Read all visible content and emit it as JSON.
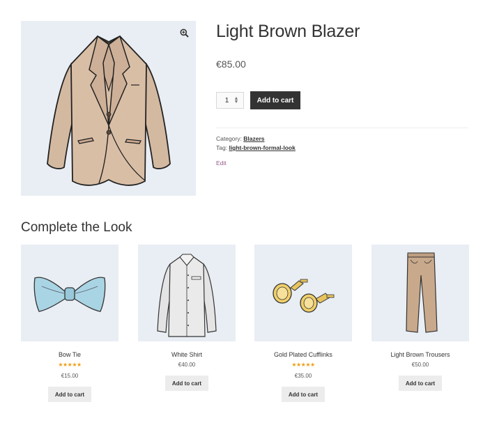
{
  "product": {
    "title": "Light Brown Blazer",
    "price": "€85.00",
    "quantity": "1",
    "add_to_cart_label": "Add to cart",
    "category_label": "Category:",
    "category_value": "Blazers",
    "tag_label": "Tag:",
    "tag_value": "light-brown-formal-look",
    "edit_label": "Edit"
  },
  "section_title": "Complete the Look",
  "related": [
    {
      "name": "Bow Tie",
      "rating": "★★★★★",
      "price": "€15.00",
      "button": "Add to cart"
    },
    {
      "name": "White Shirt",
      "rating": "",
      "price": "€40.00",
      "button": "Add to cart"
    },
    {
      "name": "Gold Plated Cufflinks",
      "rating": "★★★★★",
      "price": "€35.00",
      "button": "Add to cart"
    },
    {
      "name": "Light Brown Trousers",
      "rating": "",
      "price": "€50.00",
      "button": "Add to cart"
    }
  ],
  "colors": {
    "image_bg": "#e9eef4",
    "primary_button": "#333333",
    "secondary_button": "#ececec",
    "star": "#ee9e12",
    "edit_link": "#96588a"
  },
  "icons": {
    "zoom": "magnifier-plus-icon"
  }
}
